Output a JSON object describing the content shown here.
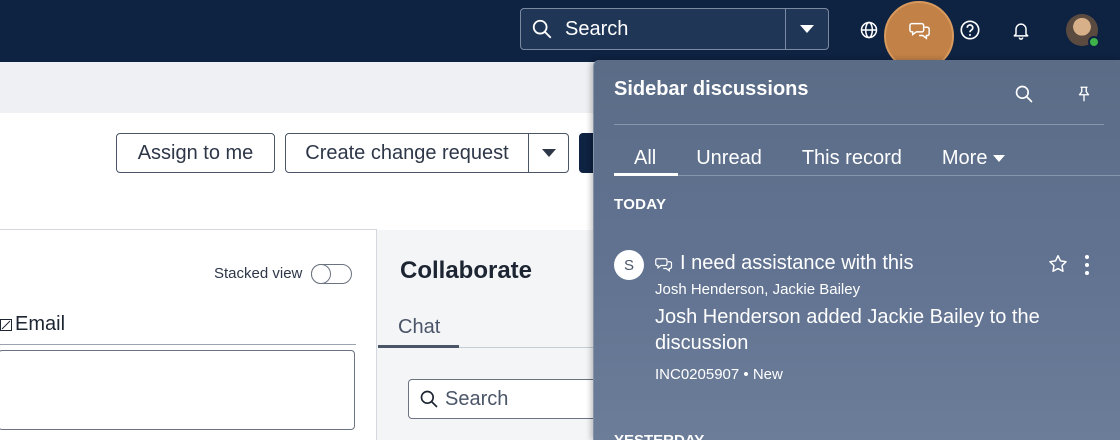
{
  "topbar": {
    "search_placeholder": "Search",
    "icons": [
      "globe-icon",
      "chat-icon",
      "help-icon",
      "bell-icon"
    ],
    "avatar_status_color": "#3db34a",
    "chat_highlight_color": "#c18147"
  },
  "page": {
    "actions": {
      "assign_to_me": "Assign to me",
      "create_change_request": "Create change request"
    },
    "stacked_view_label": "Stacked view",
    "email_label": "Email",
    "collaborate_title": "Collaborate",
    "chat_tab": "Chat",
    "search_placeholder": "Search"
  },
  "sidebar": {
    "title": "Sidebar discussions",
    "tabs": [
      {
        "label": "All",
        "active": true
      },
      {
        "label": "Unread"
      },
      {
        "label": "This record"
      },
      {
        "label": "More"
      }
    ],
    "today_label": "TODAY",
    "message": {
      "avatar_initial": "S",
      "title": "I need assistance with this",
      "participants": "Josh Henderson, Jackie Bailey",
      "body": "Josh Henderson added Jackie Bailey to the discussion",
      "reference": "INC0205907 • New"
    },
    "yesterday_label": "YESTERDAY"
  }
}
